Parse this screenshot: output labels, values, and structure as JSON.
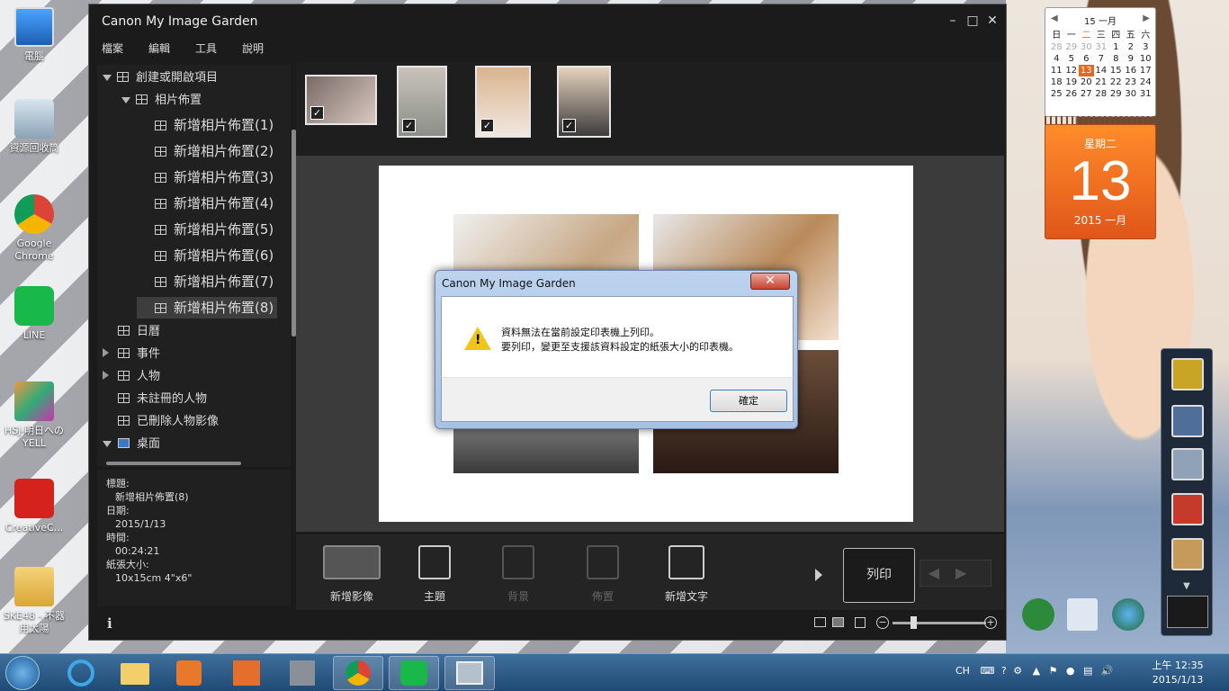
{
  "desktop": {
    "icons": [
      {
        "label": "電腦"
      },
      {
        "label": "資源回收筒"
      },
      {
        "label": "Google Chrome"
      },
      {
        "label": "LINE"
      },
      {
        "label": "HSJ-明日へのYELL"
      },
      {
        "label": "CreativeC..."
      },
      {
        "label": "SKE48 - 不器用太陽"
      }
    ]
  },
  "window": {
    "title": "Canon My Image Garden",
    "menu": [
      "檔案",
      "編輯",
      "工具",
      "說明"
    ],
    "tree": {
      "root": "創建或開啟項目",
      "group": "相片佈置",
      "items": [
        "新增相片佈置(1)",
        "新增相片佈置(2)",
        "新增相片佈置(3)",
        "新增相片佈置(4)",
        "新增相片佈置(5)",
        "新增相片佈置(6)",
        "新增相片佈置(7)",
        "新增相片佈置(8)"
      ],
      "calendar": "日曆",
      "events": "事件",
      "people": "人物",
      "unregistered": "未註冊的人物",
      "deleted": "已刪除人物影像",
      "desktop": "桌面"
    },
    "info": {
      "title_label": "標題:",
      "title_value": "新增相片佈置(8)",
      "date_label": "日期:",
      "date_value": "2015/1/13",
      "time_label": "時間:",
      "time_value": "00:24:21",
      "paper_label": "紙張大小:",
      "paper_value": "10x15cm 4\"x6\""
    },
    "toolbar": {
      "add_image": "新增影像",
      "theme": "主題",
      "background": "背景",
      "layout": "佈置",
      "add_text": "新增文字",
      "print": "列印"
    },
    "status": {
      "info_icon": "i"
    }
  },
  "dialog": {
    "title": "Canon My Image Garden",
    "line1": "資料無法在當前設定印表機上列印。",
    "line2": "要列印，變更至支援該資料設定的紙張大小的印表機。",
    "ok": "確定"
  },
  "calendar": {
    "month_header": "15 一月",
    "weekdays": [
      "日",
      "一",
      "二",
      "三",
      "四",
      "五",
      "六"
    ],
    "days": [
      "28",
      "29",
      "30",
      "31",
      "1",
      "2",
      "3",
      "4",
      "5",
      "6",
      "7",
      "8",
      "9",
      "10",
      "11",
      "12",
      "13",
      "14",
      "15",
      "16",
      "17",
      "18",
      "19",
      "20",
      "21",
      "22",
      "23",
      "24",
      "25",
      "26",
      "27",
      "28",
      "29",
      "30",
      "31"
    ],
    "today": "13",
    "weekday_name": "星期二",
    "year_month": "2015 一月"
  },
  "taskbar": {
    "lang": "CH",
    "time": "上午 12:35",
    "date": "2015/1/13"
  },
  "colors": {
    "accent_orange": "#e8661f",
    "window_bg": "#1b1b1b",
    "taskbar": "#1f4a75"
  }
}
